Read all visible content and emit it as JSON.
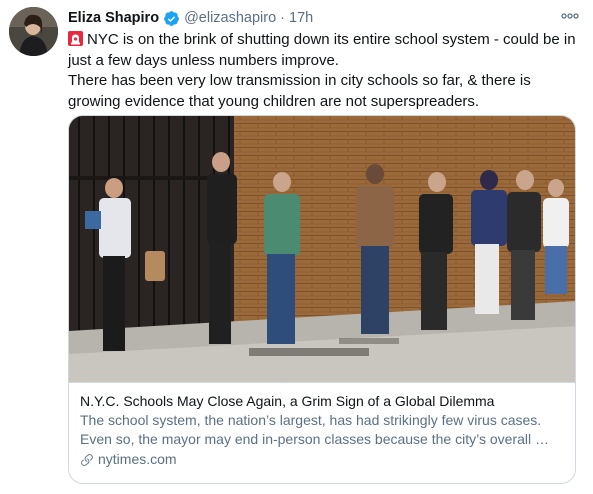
{
  "tweet": {
    "author_name": "Eliza Shapiro",
    "handle": "@elizashapiro",
    "separator": "·",
    "time": "17h",
    "more_label": "ooo",
    "line1": "NYC is on the brink of shutting down its entire school system - could be in just a few days unless numbers improve.",
    "line2": "There has been very low transmission in city schools so far, & there is growing evidence that young children are not superspreaders.",
    "icons": {
      "verified": "verified-badge-icon",
      "siren": "rotating-light-emoji",
      "link": "link-icon",
      "more": "more-options-icon"
    }
  },
  "card": {
    "title": "N.Y.C. Schools May Close Again, a Grim Sign of a Global Dilemma",
    "description": "The school system, the nation’s largest, has had strikingly few virus cases. Even so, the mayor may end in-person classes because the city’s overall …",
    "domain": "nytimes.com"
  },
  "colors": {
    "text": "#0f1419",
    "secondary": "#5b7083",
    "verified": "#1da1f2",
    "border": "#cfd9de"
  }
}
